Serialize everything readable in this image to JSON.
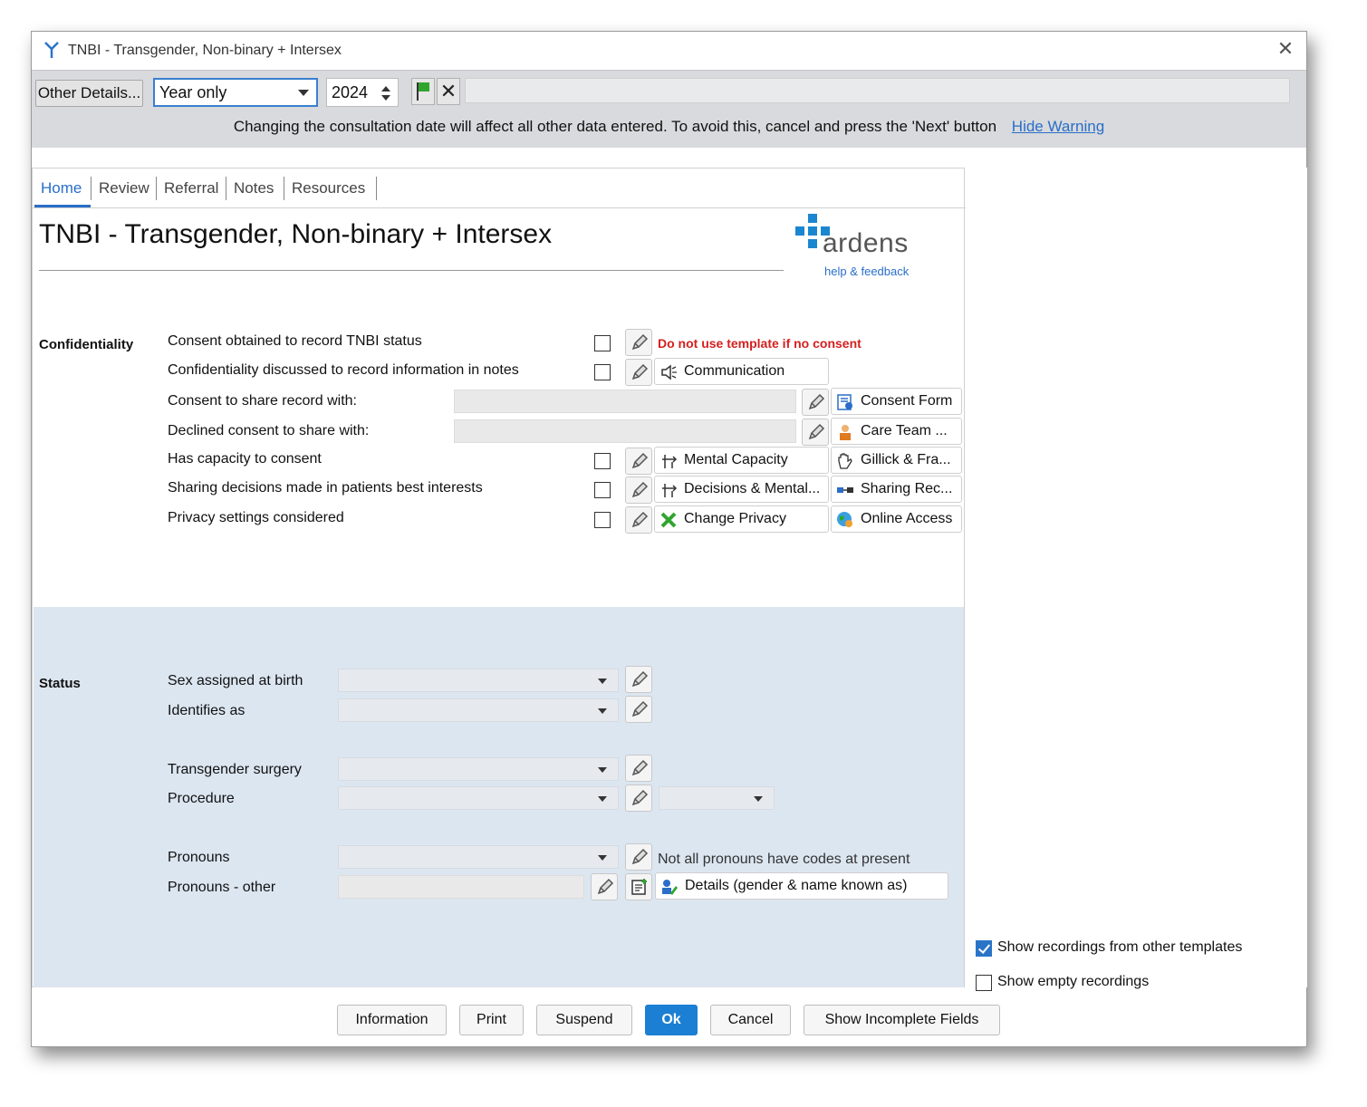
{
  "window": {
    "title": "TNBI - Transgender, Non-binary + Intersex"
  },
  "toolbar": {
    "other_details_label": "Other Details...",
    "date_mode": "Year only",
    "year": "2024",
    "warning": "Changing the consultation date will affect all other data entered. To avoid this, cancel and press the 'Next' button",
    "hide_warning": "Hide Warning"
  },
  "tabs": [
    "Home",
    "Review",
    "Referral",
    "Notes",
    "Resources"
  ],
  "page_title": "TNBI - Transgender, Non-binary + Intersex",
  "logo": {
    "name": "ardens",
    "help": "help & feedback"
  },
  "confidentiality": {
    "section": "Confidentiality",
    "rows": [
      "Consent obtained to record TNBI status",
      "Confidentiality discussed to record information in notes",
      "Consent to share record with:",
      "Declined consent to share with:",
      "Has capacity to consent",
      "Sharing decisions made in patients best interests",
      "Privacy settings considered"
    ],
    "warning": "Do not use template if no consent",
    "links": {
      "communication": "Communication",
      "consent_form": "Consent Form",
      "care_team": "Care Team ...",
      "mental_capacity": "Mental Capacity",
      "gillick": "Gillick & Fra...",
      "decisions_mental": "Decisions & Mental...",
      "sharing_rec": "Sharing Rec...",
      "change_privacy": "Change Privacy",
      "online_access": "Online Access"
    }
  },
  "status": {
    "section": "Status",
    "rows": [
      "Sex assigned at birth",
      "Identifies as",
      "Transgender surgery",
      "Procedure",
      "Pronouns",
      "Pronouns - other"
    ],
    "pronoun_note": "Not all pronouns have codes at present",
    "details_link": "Details (gender & name known as)"
  },
  "right_panel": {
    "show_other": {
      "label": "Show recordings from other templates",
      "checked": true
    },
    "show_empty": {
      "label": "Show empty recordings",
      "checked": false
    }
  },
  "footer": {
    "information": "Information",
    "print": "Print",
    "suspend": "Suspend",
    "ok": "Ok",
    "cancel": "Cancel",
    "show_incomplete": "Show Incomplete Fields"
  },
  "colors": {
    "accent": "#1b7fd3",
    "link": "#2a6ec8",
    "warning_red": "#d42020",
    "status_bg": "#dce6f1",
    "logo_cross": "#1a86d0"
  }
}
